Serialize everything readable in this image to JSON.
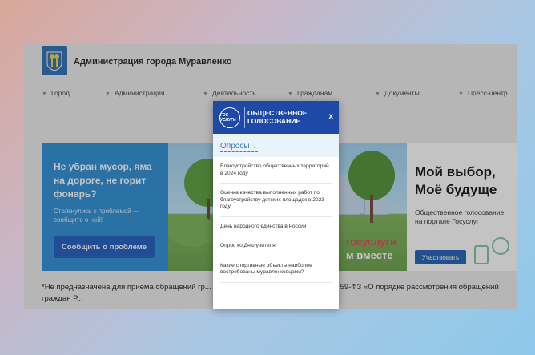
{
  "site": {
    "title": "Администрация города Муравленко"
  },
  "nav": {
    "items": [
      {
        "label": "Город"
      },
      {
        "label": "Администрация"
      },
      {
        "label": "Деятельность"
      },
      {
        "label": "Гражданам"
      },
      {
        "label": "Документы"
      },
      {
        "label": "Пресс-центр"
      }
    ]
  },
  "banner_left": {
    "title": "Не убран мусор, яма на дороге, не горит фонарь?",
    "subtitle": "Столкнулись с проблемой — сообщите о ней!",
    "button": "Сообщить о проблеме",
    "gos_part1": "госуслуги",
    "gos_part2": "м вместе"
  },
  "banner_right": {
    "title_line1": "Мой выбор,",
    "title_line2": "Моё будуще",
    "text": "Общественное голосование на портале Госуслуг",
    "button": "Участвовать"
  },
  "footnote": "*Не предназначена для приема обращений гр... ным законом от 2 мая 2006 года № 59-ФЗ «О порядке рассмотрения обращений граждан Р...",
  "modal": {
    "logo_text": "ГОС УСЛУГИ",
    "title": "ОБЩЕСТВЕННОЕ ГОЛОСОВАНИЕ",
    "close": "x",
    "tab": "Опросы",
    "polls": [
      {
        "label": "Благоустройство общественных территорий в 2024 году"
      },
      {
        "label": "Оценка качества выполненных работ по благоустройству детских площадок в 2023 году"
      },
      {
        "label": "День народного единства в России"
      },
      {
        "label": "Опрос ко Дню учителя"
      },
      {
        "label": "Какие спортивные объекты наиболее востребованы муравленковцами?"
      }
    ]
  },
  "colors": {
    "accent": "#1e49a6",
    "banner_blue": "#2b8fd6",
    "button_blue": "#1e5cc0",
    "link_blue": "#3b79c8"
  },
  "icons": {
    "logo": "coat-of-arms-icon",
    "chevron": "chevron-down-icon",
    "close": "close-icon"
  }
}
